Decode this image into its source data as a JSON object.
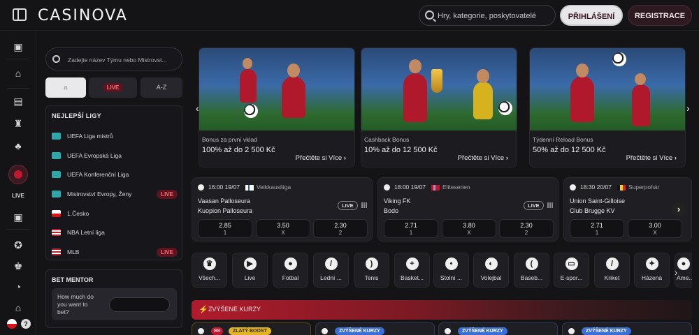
{
  "header": {
    "logo": "CASINOVA",
    "search_placeholder": "Hry, kategorie, poskytovatelé",
    "login": "PŘIHLÁŠENÍ",
    "register": "REGISTRACE"
  },
  "sidebar": {
    "search_placeholder": "Zadejte název Týmu nebo Mistrovst...",
    "tabs": {
      "live": "LIVE",
      "az": "A-Z"
    },
    "top_leagues_title": "NEJLEPŠÍ LIGY",
    "leagues": [
      {
        "name": "UEFA Liga mistrů",
        "icon": "uefa-icon",
        "live": ""
      },
      {
        "name": "UEFA Evropská Liga",
        "icon": "uefa-icon",
        "live": ""
      },
      {
        "name": "UEFA Konferenční Liga",
        "icon": "uefa-icon",
        "live": ""
      },
      {
        "name": "Mistrovství Evropy, Ženy",
        "icon": "uefa-icon",
        "live": "LIVE"
      },
      {
        "name": "1.Česko",
        "icon": "czech-flag-icon",
        "live": ""
      },
      {
        "name": "NBA Letní liga",
        "icon": "usa-flag-icon",
        "live": ""
      },
      {
        "name": "MLB",
        "icon": "usa-flag-icon",
        "live": "LIVE"
      }
    ],
    "bet_mentor": {
      "title": "BET MENTOR",
      "question": "How much do you want to bet?"
    }
  },
  "promos": [
    {
      "title": "Bonus za první vklad",
      "offer": "100% až do 2 500 Kč",
      "more": "Přečtěte si Více"
    },
    {
      "title": "Cashback Bonus",
      "offer": "10% až do 12 500 Kč",
      "more": "Přečtěte si Více"
    },
    {
      "title": "Týdenní Reload Bonus",
      "offer": "50% až do 12 500 Kč",
      "more": "Přečtěte si Více"
    }
  ],
  "matches": [
    {
      "time": "16:00",
      "date": "19/07",
      "league": "Veikkausliiga",
      "flag": "finland-flag",
      "team1": "Vaasan Palloseura",
      "team2": "Kuopion Palloseura",
      "live": "LIVE",
      "odds": [
        {
          "v": "2.85",
          "k": "1"
        },
        {
          "v": "3.50",
          "k": "X"
        },
        {
          "v": "2.30",
          "k": "2"
        }
      ]
    },
    {
      "time": "18:00",
      "date": "19/07",
      "league": "Eliteserien",
      "flag": "norway-flag",
      "team1": "Viking FK",
      "team2": "Bodo",
      "live": "LIVE",
      "odds": [
        {
          "v": "2.71",
          "k": "1"
        },
        {
          "v": "3.80",
          "k": "X"
        },
        {
          "v": "2.30",
          "k": "2"
        }
      ]
    },
    {
      "time": "18:30",
      "date": "20/07",
      "league": "Superpohár",
      "flag": "belgium-flag",
      "team1": "Union Saint-Gilloise",
      "team2": "Club Brugge KV",
      "live": "",
      "odds": [
        {
          "v": "2.71",
          "k": "1"
        },
        {
          "v": "3.00",
          "k": "X"
        },
        {
          "v": "",
          "k": ""
        }
      ]
    }
  ],
  "sports": [
    {
      "label": "Všech...",
      "icon": "trophy-icon",
      "glyph": "🏆"
    },
    {
      "label": "Live",
      "icon": "play-icon",
      "glyph": "▶"
    },
    {
      "label": "Fotbal",
      "icon": "soccer-icon",
      "glyph": "⚽"
    },
    {
      "label": "Lední ...",
      "icon": "hockey-icon",
      "glyph": "/"
    },
    {
      "label": "Tenis",
      "icon": "tennis-icon",
      "glyph": "●"
    },
    {
      "label": "Basket...",
      "icon": "basketball-icon",
      "glyph": "●"
    },
    {
      "label": "Stolní ...",
      "icon": "table-tennis-icon",
      "glyph": "●"
    },
    {
      "label": "Volejbal",
      "icon": "volleyball-icon",
      "glyph": "●"
    },
    {
      "label": "Baseb...",
      "icon": "baseball-icon",
      "glyph": "●"
    },
    {
      "label": "E-spor...",
      "icon": "gamepad-icon",
      "glyph": "▭"
    },
    {
      "label": "Kriket",
      "icon": "cricket-icon",
      "glyph": "/"
    },
    {
      "label": "Házená",
      "icon": "handball-icon",
      "glyph": "●"
    },
    {
      "label": "Ame...",
      "icon": "american-football-icon",
      "glyph": "●"
    }
  ],
  "boost": {
    "title": "ZVÝŠENÉ KURZY"
  },
  "boost_cards": [
    {
      "badge": "BB",
      "tag": "ZLATÝ BOOST"
    },
    {
      "badge": "",
      "tag": "ZVÝŠENÉ KURZY"
    },
    {
      "badge": "",
      "tag": "ZVÝŠENÉ KURZY"
    },
    {
      "badge": "",
      "tag": "ZVÝŠENÉ KURZY"
    }
  ],
  "colors": {
    "accent": "#c0182f",
    "background": "#141417",
    "card": "#1e1e23"
  }
}
